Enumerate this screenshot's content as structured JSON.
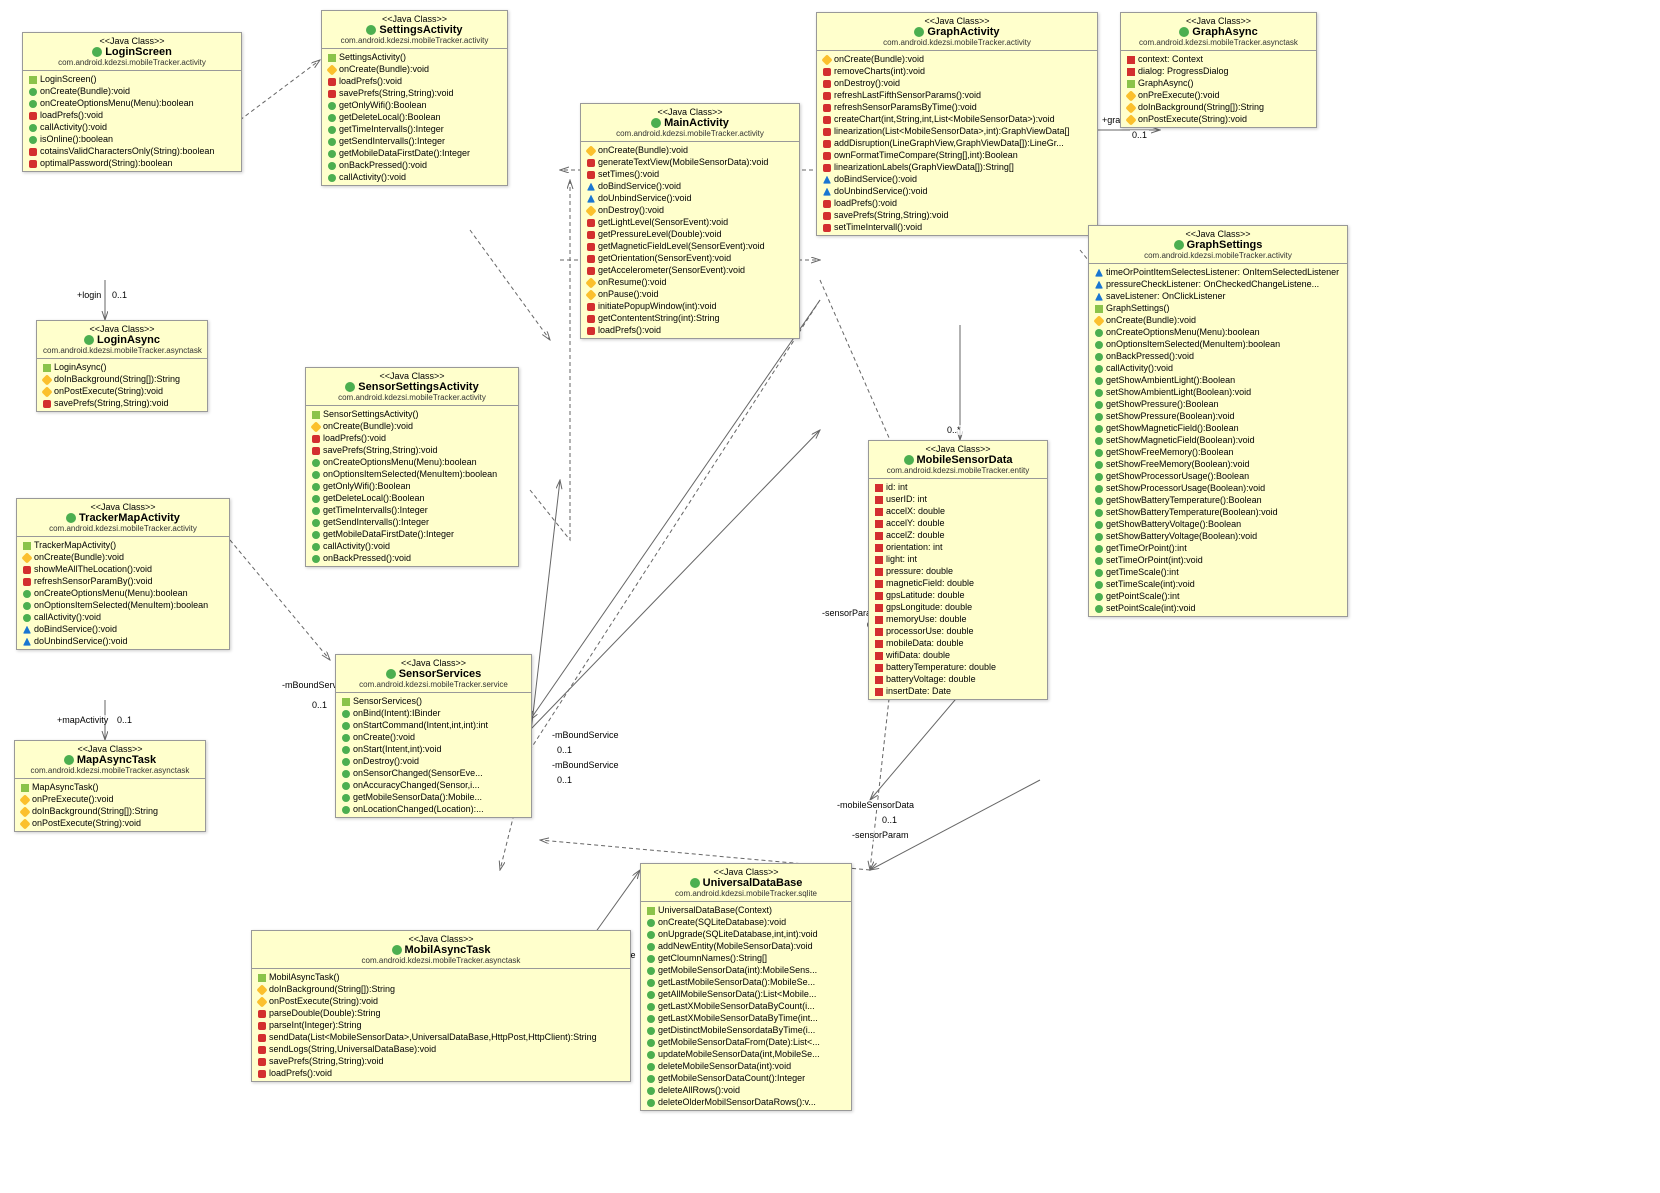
{
  "stereotype": "<<Java Class>>",
  "classes": {
    "LoginScreen": {
      "name": "LoginScreen",
      "pkg": "com.android.kdezsi.mobileTracker.activity",
      "members": [
        {
          "t": "c",
          "s": "LoginScreen()"
        },
        {
          "t": "g",
          "s": "onCreate(Bundle):void"
        },
        {
          "t": "g",
          "s": "onCreateOptionsMenu(Menu):boolean"
        },
        {
          "t": "r",
          "s": "loadPrefs():void"
        },
        {
          "t": "g",
          "s": "callActivity():void"
        },
        {
          "t": "g",
          "s": "isOnline():boolean"
        },
        {
          "t": "r",
          "s": "cotainsValidCharactersOnly(String):boolean"
        },
        {
          "t": "r",
          "s": "optimalPassword(String):boolean"
        }
      ]
    },
    "LoginAsync": {
      "name": "LoginAsync",
      "pkg": "com.android.kdezsi.mobileTracker.asynctask",
      "members": [
        {
          "t": "c",
          "s": "LoginAsync()"
        },
        {
          "t": "y",
          "s": "doInBackground(String[]):String"
        },
        {
          "t": "y",
          "s": "onPostExecute(String):void"
        },
        {
          "t": "r",
          "s": "savePrefs(String,String):void"
        }
      ]
    },
    "TrackerMapActivity": {
      "name": "TrackerMapActivity",
      "pkg": "com.android.kdezsi.mobileTracker.activity",
      "members": [
        {
          "t": "c",
          "s": "TrackerMapActivity()"
        },
        {
          "t": "y",
          "s": "onCreate(Bundle):void"
        },
        {
          "t": "r",
          "s": "showMeAllTheLocation():void"
        },
        {
          "t": "r",
          "s": "refreshSensorParamBy():void"
        },
        {
          "t": "g",
          "s": "onCreateOptionsMenu(Menu):boolean"
        },
        {
          "t": "g",
          "s": "onOptionsItemSelected(MenuItem):boolean"
        },
        {
          "t": "g",
          "s": "callActivity():void"
        },
        {
          "t": "b",
          "s": "doBindService():void"
        },
        {
          "t": "b",
          "s": "doUnbindService():void"
        }
      ]
    },
    "MapAsyncTask": {
      "name": "MapAsyncTask",
      "pkg": "com.android.kdezsi.mobileTracker.asynctask",
      "members": [
        {
          "t": "c",
          "s": "MapAsyncTask()"
        },
        {
          "t": "y",
          "s": "onPreExecute():void"
        },
        {
          "t": "y",
          "s": "doInBackground(String[]):String"
        },
        {
          "t": "y",
          "s": "onPostExecute(String):void"
        }
      ]
    },
    "SettingsActivity": {
      "name": "SettingsActivity",
      "pkg": "com.android.kdezsi.mobileTracker.activity",
      "members": [
        {
          "t": "c",
          "s": "SettingsActivity()"
        },
        {
          "t": "y",
          "s": "onCreate(Bundle):void"
        },
        {
          "t": "r",
          "s": "loadPrefs():void"
        },
        {
          "t": "r",
          "s": "savePrefs(String,String):void"
        },
        {
          "t": "g",
          "s": "getOnlyWifi():Boolean"
        },
        {
          "t": "g",
          "s": "getDeleteLocal():Boolean"
        },
        {
          "t": "g",
          "s": "getTimeIntervalls():Integer"
        },
        {
          "t": "g",
          "s": "getSendIntervalls():Integer"
        },
        {
          "t": "g",
          "s": "getMobileDataFirstDate():Integer"
        },
        {
          "t": "g",
          "s": "onBackPressed():void"
        },
        {
          "t": "g",
          "s": "callActivity():void"
        }
      ]
    },
    "SensorSettingsActivity": {
      "name": "SensorSettingsActivity",
      "pkg": "com.android.kdezsi.mobileTracker.activity",
      "members": [
        {
          "t": "c",
          "s": "SensorSettingsActivity()"
        },
        {
          "t": "y",
          "s": "onCreate(Bundle):void"
        },
        {
          "t": "r",
          "s": "loadPrefs():void"
        },
        {
          "t": "r",
          "s": "savePrefs(String,String):void"
        },
        {
          "t": "g",
          "s": "onCreateOptionsMenu(Menu):boolean"
        },
        {
          "t": "g",
          "s": "onOptionsItemSelected(MenuItem):boolean"
        },
        {
          "t": "g",
          "s": "getOnlyWifi():Boolean"
        },
        {
          "t": "g",
          "s": "getDeleteLocal():Boolean"
        },
        {
          "t": "g",
          "s": "getTimeIntervalls():Integer"
        },
        {
          "t": "g",
          "s": "getSendIntervalls():Integer"
        },
        {
          "t": "g",
          "s": "getMobileDataFirstDate():Integer"
        },
        {
          "t": "g",
          "s": "callActivity():void"
        },
        {
          "t": "g",
          "s": "onBackPressed():void"
        }
      ]
    },
    "MainActivity": {
      "name": "MainActivity",
      "pkg": "com.android.kdezsi.mobileTracker.activity",
      "members": [
        {
          "t": "y",
          "s": "onCreate(Bundle):void"
        },
        {
          "t": "r",
          "s": "generateTextView(MobileSensorData):void"
        },
        {
          "t": "r",
          "s": "setTimes():void"
        },
        {
          "t": "b",
          "s": "doBindService():void"
        },
        {
          "t": "b",
          "s": "doUnbindService():void"
        },
        {
          "t": "y",
          "s": "onDestroy():void"
        },
        {
          "t": "r",
          "s": "getLightLevel(SensorEvent):void"
        },
        {
          "t": "r",
          "s": "getPressureLevel(Double):void"
        },
        {
          "t": "r",
          "s": "getMagneticFieldLevel(SensorEvent):void"
        },
        {
          "t": "r",
          "s": "getOrientation(SensorEvent):void"
        },
        {
          "t": "r",
          "s": "getAccelerometer(SensorEvent):void"
        },
        {
          "t": "y",
          "s": "onResume():void"
        },
        {
          "t": "y",
          "s": "onPause():void"
        },
        {
          "t": "r",
          "s": "initiatePopupWindow(int):void"
        },
        {
          "t": "r",
          "s": "getContententString(int):String"
        },
        {
          "t": "r",
          "s": "loadPrefs():void"
        }
      ]
    },
    "SensorServices": {
      "name": "SensorServices",
      "pkg": "com.android.kdezsi.mobileTracker.service",
      "members": [
        {
          "t": "c",
          "s": "SensorServices()"
        },
        {
          "t": "g",
          "s": "onBind(Intent):IBinder"
        },
        {
          "t": "g",
          "s": "onStartCommand(Intent,int,int):int"
        },
        {
          "t": "g",
          "s": "onCreate():void"
        },
        {
          "t": "g",
          "s": "onStart(Intent,int):void"
        },
        {
          "t": "g",
          "s": "onDestroy():void"
        },
        {
          "t": "g",
          "s": "onSensorChanged(SensorEve..."
        },
        {
          "t": "g",
          "s": "onAccuracyChanged(Sensor,i..."
        },
        {
          "t": "g",
          "s": "getMobileSensorData():Mobile..."
        },
        {
          "t": "g",
          "s": "onLocationChanged(Location):..."
        }
      ]
    },
    "MobilAsyncTask": {
      "name": "MobilAsyncTask",
      "pkg": "com.android.kdezsi.mobileTracker.asynctask",
      "members": [
        {
          "t": "c",
          "s": "MobilAsyncTask()"
        },
        {
          "t": "y",
          "s": "doInBackground(String[]):String"
        },
        {
          "t": "y",
          "s": "onPostExecute(String):void"
        },
        {
          "t": "r",
          "s": "parseDouble(Double):String"
        },
        {
          "t": "r",
          "s": "parseInt(Integer):String"
        },
        {
          "t": "r",
          "s": "sendData(List<MobileSensorData>,UniversalDataBase,HttpPost,HttpClient):String"
        },
        {
          "t": "r",
          "s": "sendLogs(String,UniversalDataBase):void"
        },
        {
          "t": "r",
          "s": "savePrefs(String,String):void"
        },
        {
          "t": "r",
          "s": "loadPrefs():void"
        }
      ]
    },
    "GraphActivity": {
      "name": "GraphActivity",
      "pkg": "com.android.kdezsi.mobileTracker.activity",
      "members": [
        {
          "t": "y",
          "s": "onCreate(Bundle):void"
        },
        {
          "t": "r",
          "s": "removeCharts(int):void"
        },
        {
          "t": "r",
          "s": "onDestroy():void"
        },
        {
          "t": "r",
          "s": "refreshLastFifthSensorParams():void"
        },
        {
          "t": "r",
          "s": "refreshSensorParamsByTime():void"
        },
        {
          "t": "r",
          "s": "createChart(int,String,int,List<MobileSensorData>):void"
        },
        {
          "t": "r",
          "s": "linearization(List<MobileSensorData>,int):GraphViewData[]"
        },
        {
          "t": "r",
          "s": "addDisruption(LineGraphView,GraphViewData[]):LineGr..."
        },
        {
          "t": "r",
          "s": "ownFormatTimeCompare(String[],int):Boolean"
        },
        {
          "t": "r",
          "s": "linearizationLabels(GraphViewData[]):String[]"
        },
        {
          "t": "b",
          "s": "doBindService():void"
        },
        {
          "t": "b",
          "s": "doUnbindService():void"
        },
        {
          "t": "r",
          "s": "loadPrefs():void"
        },
        {
          "t": "r",
          "s": "savePrefs(String,String):void"
        },
        {
          "t": "r",
          "s": "setTimeIntervall():void"
        }
      ]
    },
    "GraphAsync": {
      "name": "GraphAsync",
      "pkg": "com.android.kdezsi.mobileTracker.asynctask",
      "members": [
        {
          "t": "f",
          "s": "context: Context"
        },
        {
          "t": "f",
          "s": "dialog: ProgressDialog"
        },
        {
          "t": "c",
          "s": "GraphAsync()"
        },
        {
          "t": "y",
          "s": "onPreExecute():void"
        },
        {
          "t": "y",
          "s": "doInBackground(String[]):String"
        },
        {
          "t": "y",
          "s": "onPostExecute(String):void"
        }
      ]
    },
    "GraphSettings": {
      "name": "GraphSettings",
      "pkg": "com.android.kdezsi.mobileTracker.activity",
      "members": [
        {
          "t": "b",
          "s": "timeOrPointItemSelectesListener: OnItemSelectedListener"
        },
        {
          "t": "b",
          "s": "pressureCheckListener: OnCheckedChangeListene..."
        },
        {
          "t": "b",
          "s": "saveListener: OnClickListener"
        },
        {
          "t": "c",
          "s": "GraphSettings()"
        },
        {
          "t": "y",
          "s": "onCreate(Bundle):void"
        },
        {
          "t": "g",
          "s": "onCreateOptionsMenu(Menu):boolean"
        },
        {
          "t": "g",
          "s": "onOptionsItemSelected(MenuItem):boolean"
        },
        {
          "t": "g",
          "s": "onBackPressed():void"
        },
        {
          "t": "g",
          "s": "callActivity():void"
        },
        {
          "t": "g",
          "s": "getShowAmbientLight():Boolean"
        },
        {
          "t": "g",
          "s": "setShowAmbientLight(Boolean):void"
        },
        {
          "t": "g",
          "s": "getShowPressure():Boolean"
        },
        {
          "t": "g",
          "s": "setShowPressure(Boolean):void"
        },
        {
          "t": "g",
          "s": "getShowMagneticField():Boolean"
        },
        {
          "t": "g",
          "s": "setShowMagneticField(Boolean):void"
        },
        {
          "t": "g",
          "s": "getShowFreeMemory():Boolean"
        },
        {
          "t": "g",
          "s": "setShowFreeMemory(Boolean):void"
        },
        {
          "t": "g",
          "s": "getShowProcessorUsage():Boolean"
        },
        {
          "t": "g",
          "s": "setShowProcessorUsage(Boolean):void"
        },
        {
          "t": "g",
          "s": "getShowBatteryTemperature():Boolean"
        },
        {
          "t": "g",
          "s": "setShowBatteryTemperature(Boolean):void"
        },
        {
          "t": "g",
          "s": "getShowBatteryVoltage():Boolean"
        },
        {
          "t": "g",
          "s": "setShowBatteryVoltage(Boolean):void"
        },
        {
          "t": "g",
          "s": "getTimeOrPoint():int"
        },
        {
          "t": "g",
          "s": "setTimeOrPoint(int):void"
        },
        {
          "t": "g",
          "s": "getTimeScale():int"
        },
        {
          "t": "g",
          "s": "setTimeScale(int):void"
        },
        {
          "t": "g",
          "s": "getPointScale():int"
        },
        {
          "t": "g",
          "s": "setPointScale(int):void"
        }
      ]
    },
    "MobileSensorData": {
      "name": "MobileSensorData",
      "pkg": "com.android.kdezsi.mobileTracker.entity",
      "members": [
        {
          "t": "f",
          "s": "id: int"
        },
        {
          "t": "f",
          "s": "userID: int"
        },
        {
          "t": "f",
          "s": "accelX: double"
        },
        {
          "t": "f",
          "s": "accelY: double"
        },
        {
          "t": "f",
          "s": "accelZ: double"
        },
        {
          "t": "f",
          "s": "orientation: int"
        },
        {
          "t": "f",
          "s": "light: int"
        },
        {
          "t": "f",
          "s": "pressure: double"
        },
        {
          "t": "f",
          "s": "magneticField: double"
        },
        {
          "t": "f",
          "s": "gpsLatitude: double"
        },
        {
          "t": "f",
          "s": "gpsLongitude: double"
        },
        {
          "t": "f",
          "s": "memoryUse: double"
        },
        {
          "t": "f",
          "s": "processorUse: double"
        },
        {
          "t": "f",
          "s": "mobileData: double"
        },
        {
          "t": "f",
          "s": "wifiData: double"
        },
        {
          "t": "f",
          "s": "batteryTemperature: double"
        },
        {
          "t": "f",
          "s": "batteryVoltage: double"
        },
        {
          "t": "f",
          "s": "insertDate: Date"
        }
      ]
    },
    "UniversalDataBase": {
      "name": "UniversalDataBase",
      "pkg": "com.android.kdezsi.mobileTracker.sqlite",
      "members": [
        {
          "t": "c",
          "s": "UniversalDataBase(Context)"
        },
        {
          "t": "g",
          "s": "onCreate(SQLiteDatabase):void"
        },
        {
          "t": "g",
          "s": "onUpgrade(SQLiteDatabase,int,int):void"
        },
        {
          "t": "g",
          "s": "addNewEntity(MobileSensorData):void"
        },
        {
          "t": "g",
          "s": "getCloumnNames():String[]"
        },
        {
          "t": "g",
          "s": "getMobileSensorData(int):MobileSens..."
        },
        {
          "t": "g",
          "s": "getLastMobileSensorData():MobileSe..."
        },
        {
          "t": "g",
          "s": "getAllMobileSensorData():List<Mobile..."
        },
        {
          "t": "g",
          "s": "getLastXMobileSensorDataByCount(i..."
        },
        {
          "t": "g",
          "s": "getLastXMobileSensorDataByTime(int..."
        },
        {
          "t": "g",
          "s": "getDistinctMobileSensordataByTime(i..."
        },
        {
          "t": "g",
          "s": "getMobileSensorDataFrom(Date):List<..."
        },
        {
          "t": "g",
          "s": "updateMobileSensorData(int,MobileSe..."
        },
        {
          "t": "g",
          "s": "deleteMobileSensorData(int):void"
        },
        {
          "t": "g",
          "s": "getMobileSensorDataCount():Integer"
        },
        {
          "t": "g",
          "s": "deleteAllRows():void"
        },
        {
          "t": "g",
          "s": "deleteOlderMobilSensorDataRows():v..."
        }
      ]
    }
  },
  "labels": {
    "login": "+login",
    "m01": "0..1",
    "mapActivity": "+mapActivity",
    "mBoundService": "-mBoundService",
    "universalDataBase": "-universalDataBase",
    "sensorParam": "-sensorParam",
    "mobileSensorData": "-mobileSensorData",
    "graphActivity": "+graphActivity",
    "zerostar": "0..*"
  }
}
